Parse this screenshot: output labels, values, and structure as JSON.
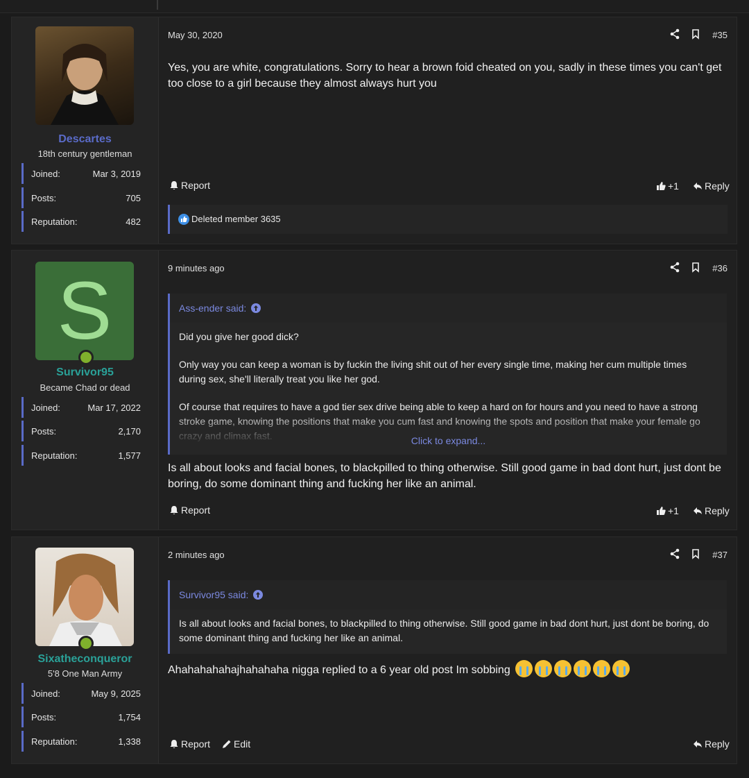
{
  "posts": [
    {
      "user": {
        "name": "Descartes",
        "title": "18th century gentleman",
        "joined": "Mar 3, 2019",
        "posts": "705",
        "reputation": "482",
        "name_color": "#5a6bc8"
      },
      "date": "May 30, 2020",
      "number": "#35",
      "message": "Yes, you are white, congratulations. Sorry to hear a brown foid cheated on you, sadly in these times you can't get too close to a girl because they almost always hurt you",
      "actions": {
        "report": "Report",
        "like_count": "+1",
        "reply": "Reply"
      },
      "reactions": "Deleted member 3635"
    },
    {
      "user": {
        "name": "Survivor95",
        "title": "Became Chad or dead",
        "joined": "Mar 17, 2022",
        "posts": "2,170",
        "reputation": "1,577",
        "avatar_letter": "S",
        "name_color": "#2aa198"
      },
      "date": "9 minutes ago",
      "number": "#36",
      "quote": {
        "author": "Ass-ender said:",
        "paragraphs": [
          "Did you give her good dick?",
          "Only way you can keep a woman is by fuckin the living shit out of her every single time, making her cum multiple times during sex, she'll literally treat you like her god.",
          "Of course that requires to have a god tier sex drive being able to keep a hard on for hours and you need to have a strong stroke game, knowing the positions that make you cum fast and knowing the spots and position that make your female go crazy and climax fast."
        ],
        "expand": "Click to expand..."
      },
      "message": "Is all about looks and facial bones, to blackpilled to thing otherwise. Still good game in bad dont hurt, just dont be boring, do some dominant thing and fucking her like an animal.",
      "actions": {
        "report": "Report",
        "like_count": "+1",
        "reply": "Reply"
      }
    },
    {
      "user": {
        "name": "Sixatheconqueror",
        "title": "5'8 One Man Army",
        "joined": "May 9, 2025",
        "posts": "1,754",
        "reputation": "1,338",
        "name_color": "#2aa198"
      },
      "date": "2 minutes ago",
      "number": "#37",
      "quote": {
        "author": "Survivor95 said:",
        "paragraphs": [
          "Is all about looks and facial bones, to blackpilled to thing otherwise. Still good game in bad dont hurt, just dont be boring, do some dominant thing and fucking her like an animal."
        ]
      },
      "message": "Ahahahahahajhahahaha nigga replied to a 6 year old post Im sobbing",
      "actions": {
        "report": "Report",
        "edit": "Edit",
        "reply": "Reply"
      }
    }
  ],
  "labels": {
    "joined": "Joined:",
    "posts": "Posts:",
    "reputation": "Reputation:"
  }
}
